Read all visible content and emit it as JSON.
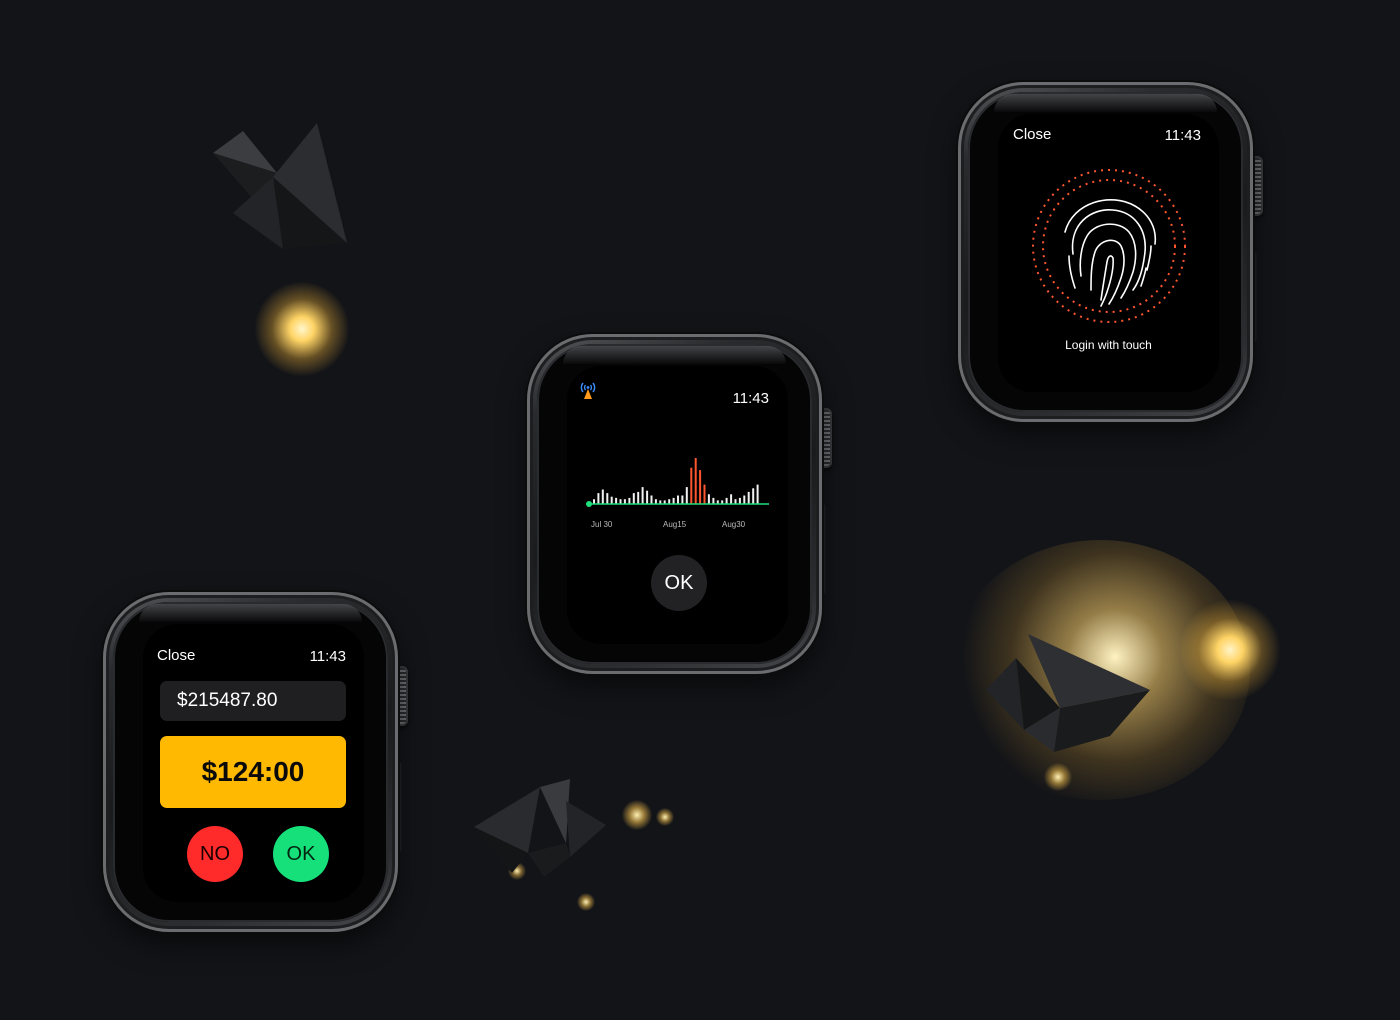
{
  "watches": {
    "payment": {
      "close_label": "Close",
      "time": "11:43",
      "balance": "$215487.80",
      "amount": "$124:00",
      "no_label": "NO",
      "ok_label": "OK",
      "colors": {
        "amount_bg": "#ffb900",
        "no_bg": "#ff2a2a",
        "ok_bg": "#16e07a"
      }
    },
    "stats": {
      "signal_icon": "broadcast-tower-icon",
      "time": "11:43",
      "ok_label": "OK",
      "chart_data": {
        "type": "bar",
        "x_ticks": [
          "Jul 30",
          "Aug15",
          "Aug30"
        ],
        "values": [
          4,
          9,
          12,
          9,
          6,
          5,
          4,
          4,
          5,
          9,
          10,
          14,
          11,
          7,
          4,
          3,
          3,
          4,
          5,
          7,
          7,
          14,
          30,
          38,
          28,
          16,
          8,
          5,
          3,
          3,
          5,
          8,
          4,
          5,
          7,
          10,
          13,
          16
        ],
        "highlighted_indices": [
          22,
          23,
          24,
          25
        ],
        "colors": {
          "bar": "#f2f2f2",
          "highlight": "#ff5630",
          "baseline": "#1fe07a"
        }
      }
    },
    "login": {
      "close_label": "Close",
      "time": "11:43",
      "prompt": "Login with touch",
      "fingerprint_icon": "fingerprint-icon",
      "colors": {
        "ring": "#ff5630"
      }
    }
  }
}
